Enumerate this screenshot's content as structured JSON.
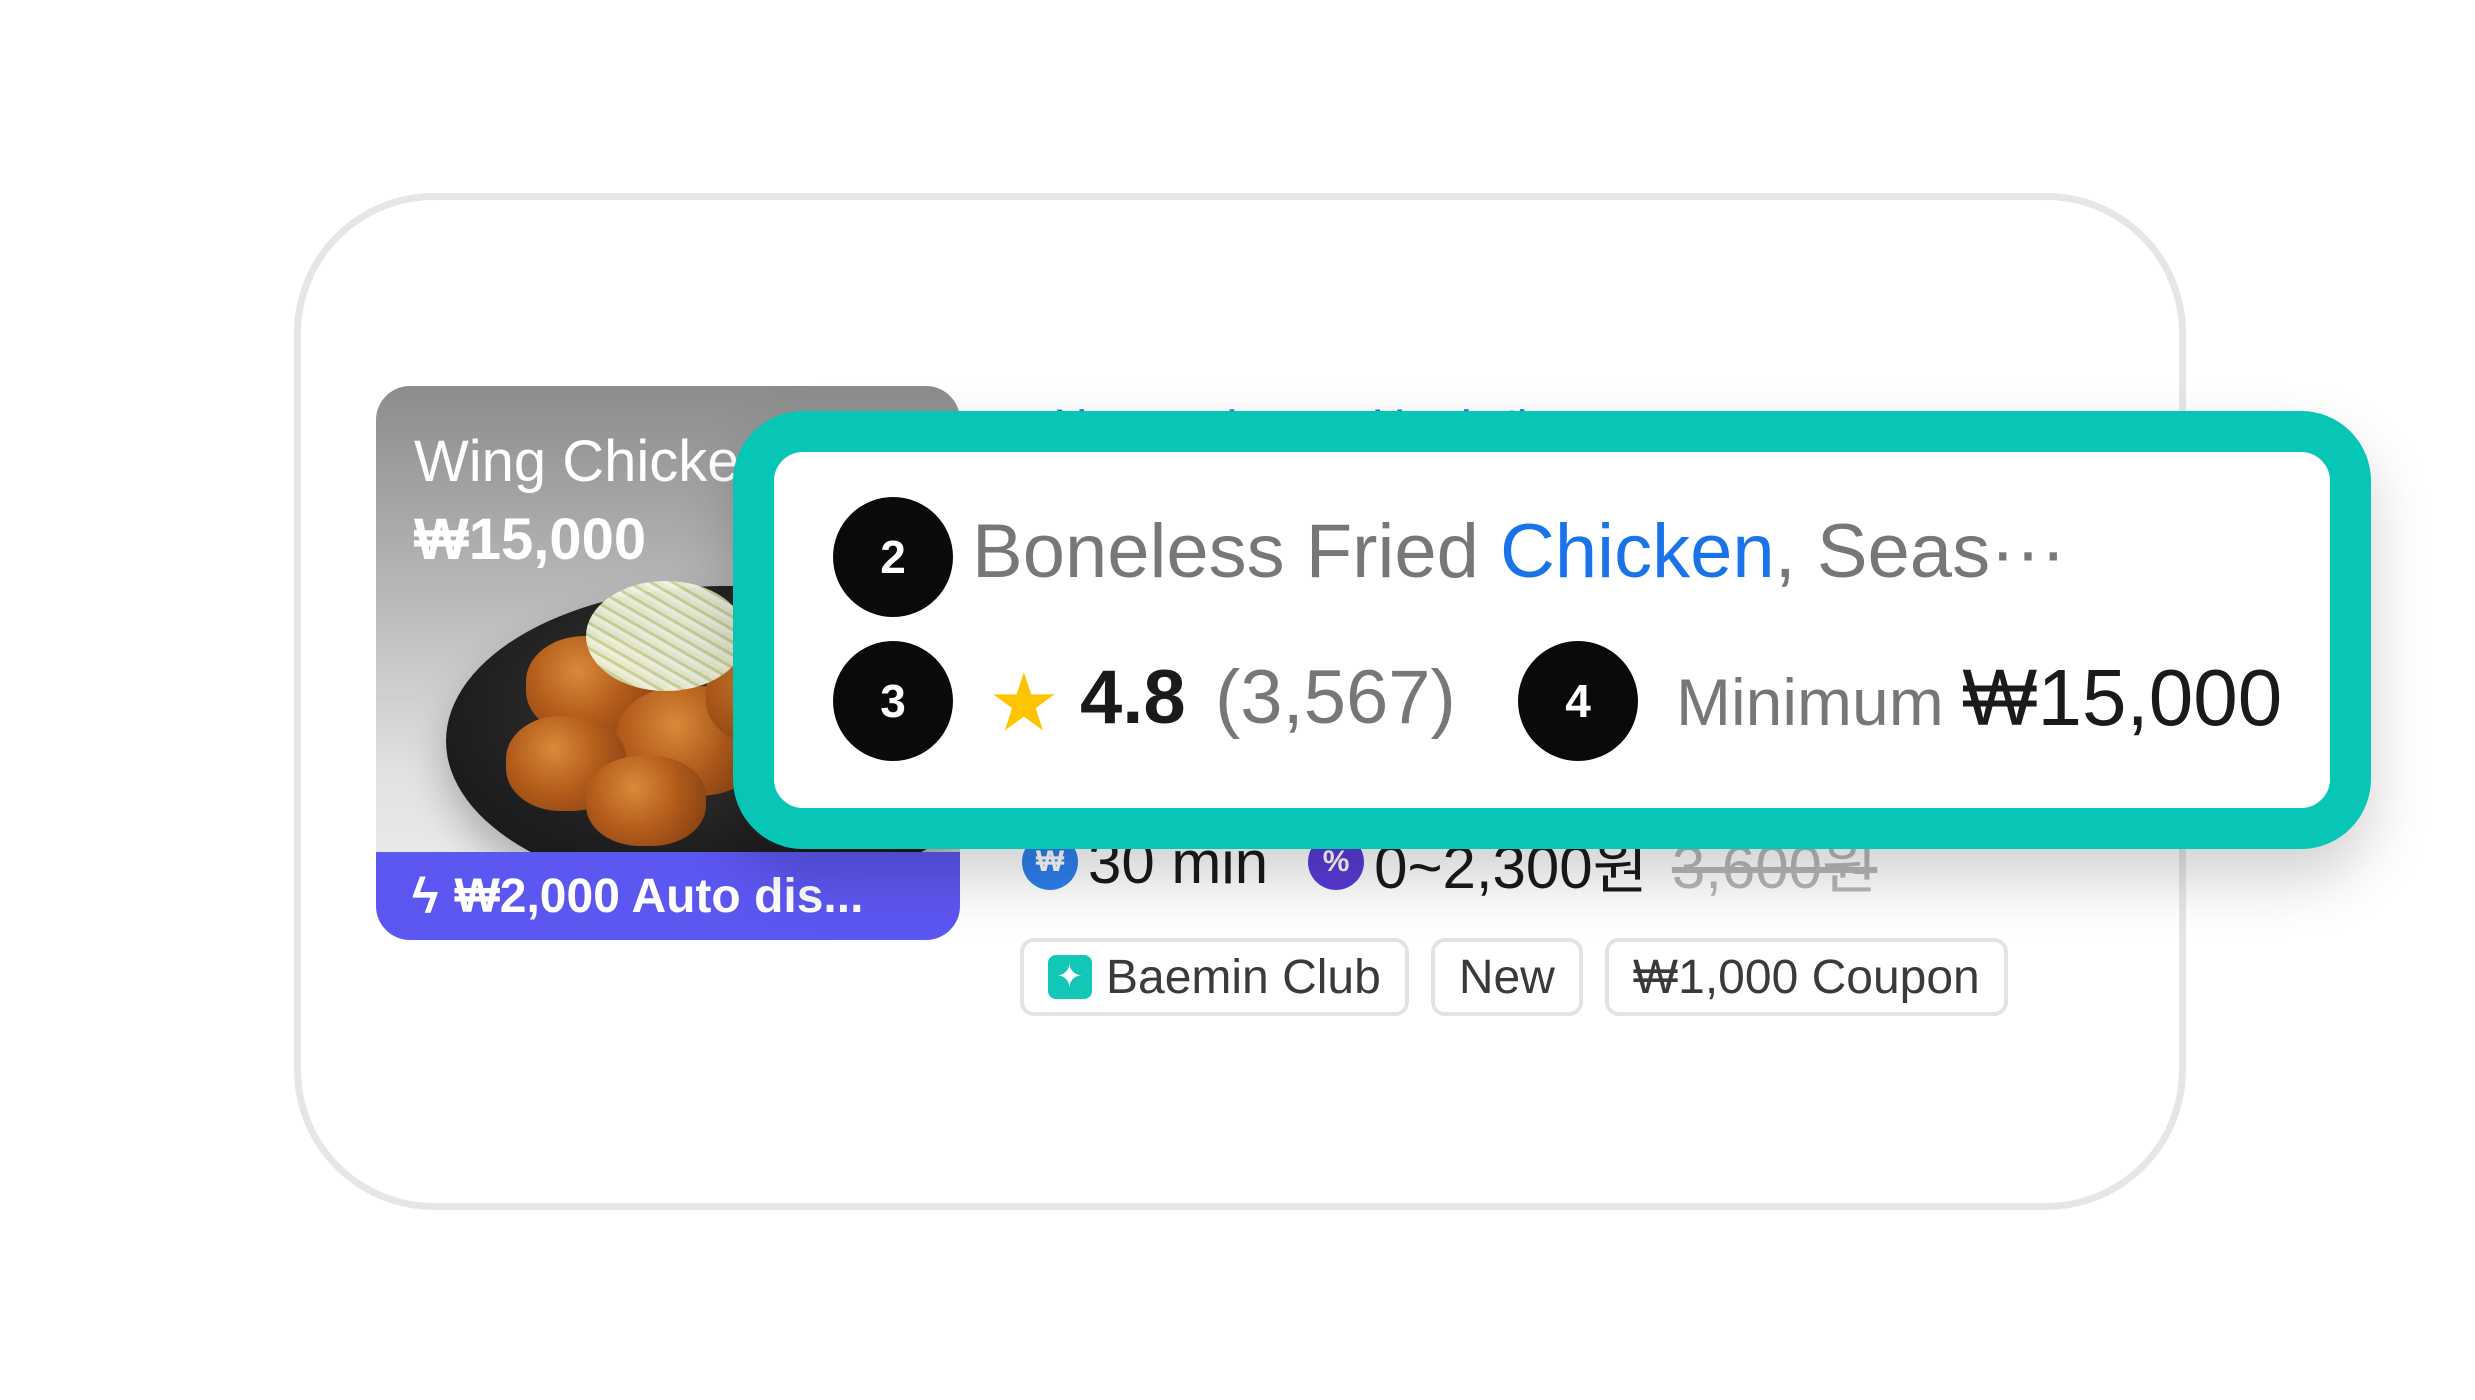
{
  "card": {
    "thumbnail": {
      "title": "Wing Chicken",
      "price": "₩15,000",
      "discount": "₩2,000 Auto dis...",
      "discount_icon": "lightning-bolt-icon"
    },
    "partial_top_text": "최근 3번 주문한 가게",
    "meta": {
      "delivery_time": "30 min",
      "delivery_fee": "0~2,300원",
      "original_fee": "3,600원"
    },
    "tags": [
      {
        "label": "Baemin Club",
        "icon": "baemin-club-icon"
      },
      {
        "label": "New"
      },
      {
        "label": "₩1,000 Coupon"
      }
    ]
  },
  "overlay": {
    "accent_color": "#07c6b5",
    "badges": [
      "2",
      "3",
      "4"
    ],
    "menu": {
      "before": "Boneless Fried ",
      "highlight": "Chicken",
      "after": ", Seas···"
    },
    "rating": "4.8",
    "reviews": "(3,567)",
    "minimum_label": "Minimum",
    "minimum_value": "₩15,000"
  }
}
